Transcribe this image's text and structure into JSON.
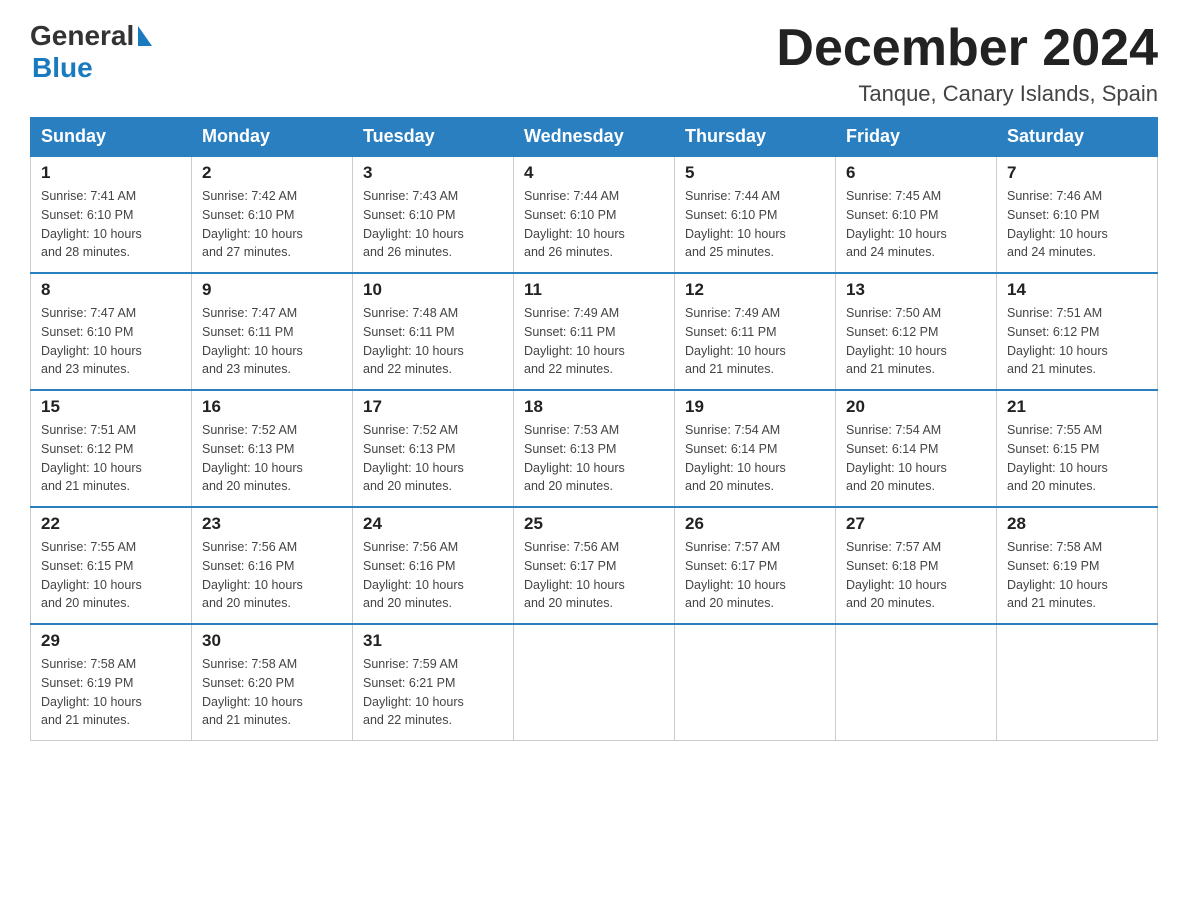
{
  "logo": {
    "general": "General",
    "blue": "Blue"
  },
  "title": "December 2024",
  "location": "Tanque, Canary Islands, Spain",
  "headers": [
    "Sunday",
    "Monday",
    "Tuesday",
    "Wednesday",
    "Thursday",
    "Friday",
    "Saturday"
  ],
  "weeks": [
    [
      {
        "day": "1",
        "sunrise": "7:41 AM",
        "sunset": "6:10 PM",
        "daylight": "10 hours and 28 minutes."
      },
      {
        "day": "2",
        "sunrise": "7:42 AM",
        "sunset": "6:10 PM",
        "daylight": "10 hours and 27 minutes."
      },
      {
        "day": "3",
        "sunrise": "7:43 AM",
        "sunset": "6:10 PM",
        "daylight": "10 hours and 26 minutes."
      },
      {
        "day": "4",
        "sunrise": "7:44 AM",
        "sunset": "6:10 PM",
        "daylight": "10 hours and 26 minutes."
      },
      {
        "day": "5",
        "sunrise": "7:44 AM",
        "sunset": "6:10 PM",
        "daylight": "10 hours and 25 minutes."
      },
      {
        "day": "6",
        "sunrise": "7:45 AM",
        "sunset": "6:10 PM",
        "daylight": "10 hours and 24 minutes."
      },
      {
        "day": "7",
        "sunrise": "7:46 AM",
        "sunset": "6:10 PM",
        "daylight": "10 hours and 24 minutes."
      }
    ],
    [
      {
        "day": "8",
        "sunrise": "7:47 AM",
        "sunset": "6:10 PM",
        "daylight": "10 hours and 23 minutes."
      },
      {
        "day": "9",
        "sunrise": "7:47 AM",
        "sunset": "6:11 PM",
        "daylight": "10 hours and 23 minutes."
      },
      {
        "day": "10",
        "sunrise": "7:48 AM",
        "sunset": "6:11 PM",
        "daylight": "10 hours and 22 minutes."
      },
      {
        "day": "11",
        "sunrise": "7:49 AM",
        "sunset": "6:11 PM",
        "daylight": "10 hours and 22 minutes."
      },
      {
        "day": "12",
        "sunrise": "7:49 AM",
        "sunset": "6:11 PM",
        "daylight": "10 hours and 21 minutes."
      },
      {
        "day": "13",
        "sunrise": "7:50 AM",
        "sunset": "6:12 PM",
        "daylight": "10 hours and 21 minutes."
      },
      {
        "day": "14",
        "sunrise": "7:51 AM",
        "sunset": "6:12 PM",
        "daylight": "10 hours and 21 minutes."
      }
    ],
    [
      {
        "day": "15",
        "sunrise": "7:51 AM",
        "sunset": "6:12 PM",
        "daylight": "10 hours and 21 minutes."
      },
      {
        "day": "16",
        "sunrise": "7:52 AM",
        "sunset": "6:13 PM",
        "daylight": "10 hours and 20 minutes."
      },
      {
        "day": "17",
        "sunrise": "7:52 AM",
        "sunset": "6:13 PM",
        "daylight": "10 hours and 20 minutes."
      },
      {
        "day": "18",
        "sunrise": "7:53 AM",
        "sunset": "6:13 PM",
        "daylight": "10 hours and 20 minutes."
      },
      {
        "day": "19",
        "sunrise": "7:54 AM",
        "sunset": "6:14 PM",
        "daylight": "10 hours and 20 minutes."
      },
      {
        "day": "20",
        "sunrise": "7:54 AM",
        "sunset": "6:14 PM",
        "daylight": "10 hours and 20 minutes."
      },
      {
        "day": "21",
        "sunrise": "7:55 AM",
        "sunset": "6:15 PM",
        "daylight": "10 hours and 20 minutes."
      }
    ],
    [
      {
        "day": "22",
        "sunrise": "7:55 AM",
        "sunset": "6:15 PM",
        "daylight": "10 hours and 20 minutes."
      },
      {
        "day": "23",
        "sunrise": "7:56 AM",
        "sunset": "6:16 PM",
        "daylight": "10 hours and 20 minutes."
      },
      {
        "day": "24",
        "sunrise": "7:56 AM",
        "sunset": "6:16 PM",
        "daylight": "10 hours and 20 minutes."
      },
      {
        "day": "25",
        "sunrise": "7:56 AM",
        "sunset": "6:17 PM",
        "daylight": "10 hours and 20 minutes."
      },
      {
        "day": "26",
        "sunrise": "7:57 AM",
        "sunset": "6:17 PM",
        "daylight": "10 hours and 20 minutes."
      },
      {
        "day": "27",
        "sunrise": "7:57 AM",
        "sunset": "6:18 PM",
        "daylight": "10 hours and 20 minutes."
      },
      {
        "day": "28",
        "sunrise": "7:58 AM",
        "sunset": "6:19 PM",
        "daylight": "10 hours and 21 minutes."
      }
    ],
    [
      {
        "day": "29",
        "sunrise": "7:58 AM",
        "sunset": "6:19 PM",
        "daylight": "10 hours and 21 minutes."
      },
      {
        "day": "30",
        "sunrise": "7:58 AM",
        "sunset": "6:20 PM",
        "daylight": "10 hours and 21 minutes."
      },
      {
        "day": "31",
        "sunrise": "7:59 AM",
        "sunset": "6:21 PM",
        "daylight": "10 hours and 22 minutes."
      },
      null,
      null,
      null,
      null
    ]
  ],
  "labels": {
    "sunrise": "Sunrise:",
    "sunset": "Sunset:",
    "daylight": "Daylight:"
  }
}
